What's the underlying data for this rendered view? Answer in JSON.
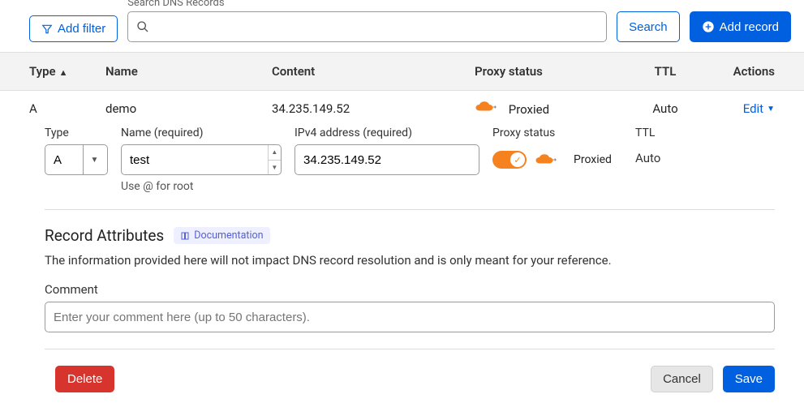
{
  "toolbar": {
    "add_filter_label": "Add filter",
    "search_label": "Search DNS Records",
    "search_value": "",
    "search_button_label": "Search",
    "add_record_label": "Add record"
  },
  "columns": {
    "type": "Type",
    "name": "Name",
    "content": "Content",
    "proxy": "Proxy status",
    "ttl": "TTL",
    "actions": "Actions"
  },
  "record": {
    "type": "A",
    "name": "demo",
    "content": "34.235.149.52",
    "proxy": "Proxied",
    "ttl": "Auto",
    "edit_label": "Edit"
  },
  "edit": {
    "type_label": "Type",
    "type_value": "A",
    "name_label": "Name (required)",
    "name_value": "test",
    "name_hint": "Use @ for root",
    "ipv4_label": "IPv4 address (required)",
    "ipv4_value": "34.235.149.52",
    "proxy_label": "Proxy status",
    "proxy_value": "Proxied",
    "ttl_label": "TTL",
    "ttl_value": "Auto"
  },
  "attributes": {
    "title": "Record Attributes",
    "doc_label": "Documentation",
    "description": "The information provided here will not impact DNS record resolution and is only meant for your reference.",
    "comment_label": "Comment",
    "comment_placeholder": "Enter your comment here (up to 50 characters).",
    "comment_value": ""
  },
  "footer": {
    "delete_label": "Delete",
    "cancel_label": "Cancel",
    "save_label": "Save"
  }
}
